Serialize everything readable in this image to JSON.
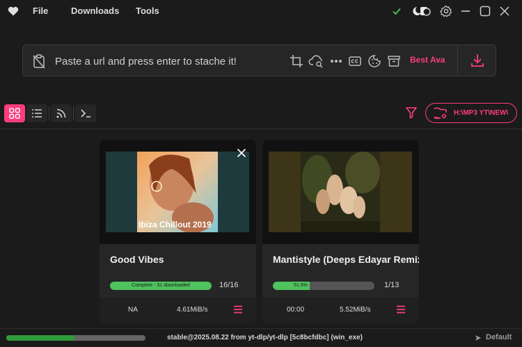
{
  "menu": {
    "file": "File",
    "downloads": "Downloads",
    "tools": "Tools"
  },
  "window_controls": [
    "check-icon",
    "theme-toggle-icon",
    "gear-icon",
    "minimize-icon",
    "maximize-icon",
    "close-icon"
  ],
  "url_bar": {
    "placeholder": "Paste a url and press enter to stache it!",
    "quality": "Best Ava",
    "tools": [
      "crop-icon",
      "cloud-search-icon",
      "more-icon",
      "subtitles-icon",
      "cookie-icon",
      "archive-icon"
    ]
  },
  "view": {
    "modes": [
      "grid-view-icon",
      "list-view-icon",
      "rss-icon",
      "terminal-icon"
    ],
    "active": "grid-view-icon",
    "folder_path": "H:\\MP3 YT\\NEW\\"
  },
  "cards": [
    {
      "title": "Good Vibes",
      "thumbnail_caption": "Ibiza Chillout 2019",
      "progress_text": "Complete - 31 downloaded",
      "progress_fraction": 1.0,
      "count": "16/16",
      "left_stat": "NA",
      "speed": "4.61MiB/s",
      "closable": true
    },
    {
      "title": "Mantistyle (Deeps Edayar Remix)",
      "thumbnail_caption": "",
      "progress_text": "51.9%",
      "progress_fraction": 0.36,
      "count": "1/13",
      "left_stat": "00:00",
      "speed": "5.52MiB/s",
      "closable": false
    }
  ],
  "status": {
    "progress_fraction": 0.49,
    "version": "stable@2025.08.22 from yt-dlp/yt-dlp [5c8bcfdbc] (win_exe)",
    "profile": "Default"
  },
  "colors": {
    "accent": "#ff3d7f",
    "success": "#4fc35e",
    "background": "#1b1b1b"
  }
}
